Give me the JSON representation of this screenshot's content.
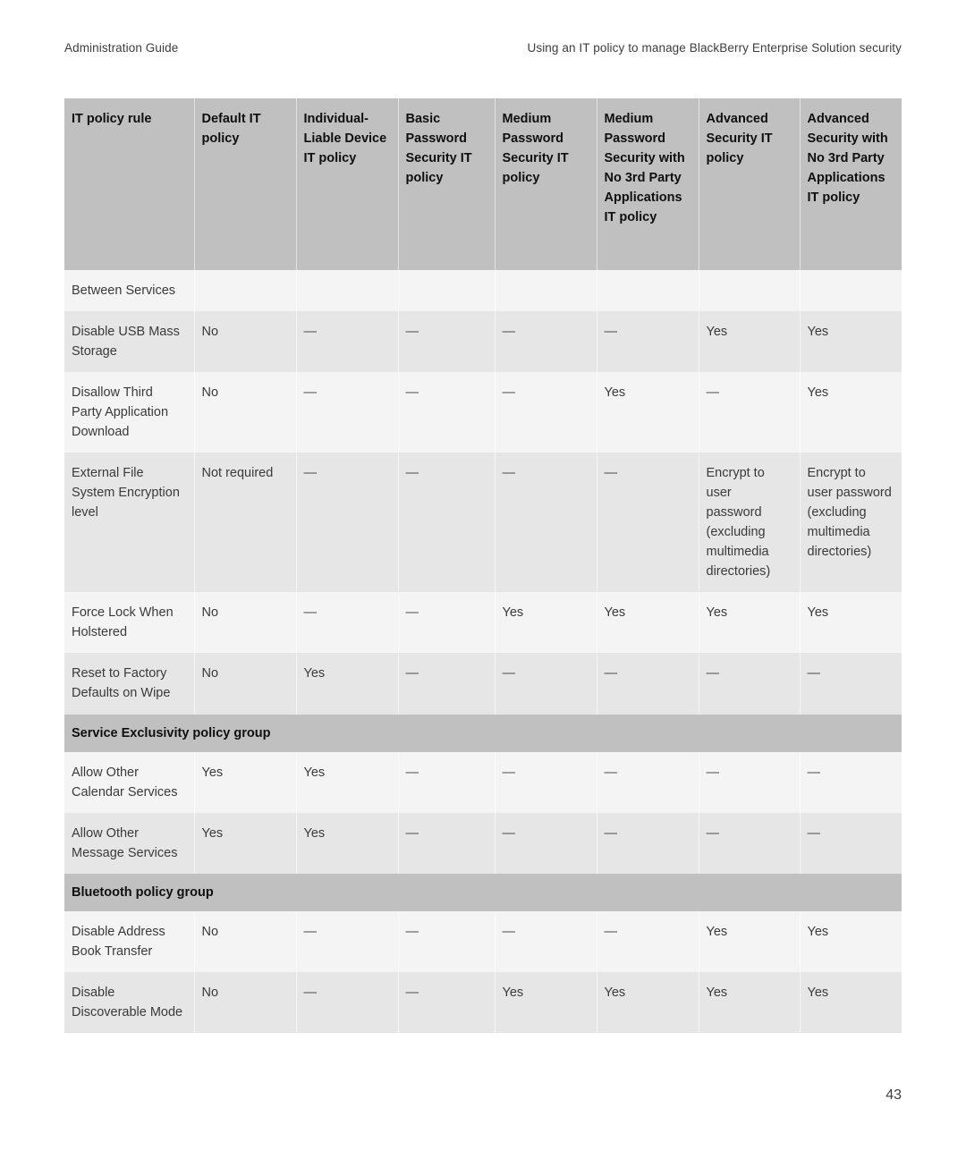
{
  "running_header": {
    "left": "Administration Guide",
    "right": "Using an IT policy to manage BlackBerry Enterprise Solution security"
  },
  "folio": "43",
  "table": {
    "columns": [
      "IT policy rule",
      "Default IT policy",
      "Individual-Liable Device IT policy",
      "Basic Password Security IT policy",
      "Medium Password Security IT policy",
      "Medium Password Security with No 3rd Party Applications IT policy",
      "Advanced Security IT policy",
      "Advanced Security with No 3rd Party Applications IT policy"
    ],
    "rows": [
      {
        "type": "data",
        "cells": [
          "Between Services",
          "",
          "",
          "",
          "",
          "",
          "",
          ""
        ]
      },
      {
        "type": "data",
        "cells": [
          "Disable USB Mass Storage",
          "No",
          "—",
          "—",
          "—",
          "—",
          "Yes",
          "Yes"
        ]
      },
      {
        "type": "data",
        "cells": [
          "Disallow Third Party Application Download",
          "No",
          "—",
          "—",
          "—",
          "Yes",
          "—",
          "Yes"
        ]
      },
      {
        "type": "data",
        "cells": [
          "External File System Encryption level",
          "Not required",
          "—",
          "—",
          "—",
          "—",
          "Encrypt to user password (excluding multimedia directories)",
          "Encrypt to user password (excluding multimedia directories)"
        ]
      },
      {
        "type": "data",
        "cells": [
          "Force Lock When Holstered",
          "No",
          "—",
          "—",
          "Yes",
          "Yes",
          "Yes",
          "Yes"
        ]
      },
      {
        "type": "data",
        "cells": [
          "Reset to Factory Defaults on Wipe",
          "No",
          "Yes",
          "—",
          "—",
          "—",
          "—",
          "—"
        ]
      },
      {
        "type": "group",
        "label": "Service Exclusivity policy group"
      },
      {
        "type": "data",
        "cells": [
          "Allow Other Calendar Services",
          "Yes",
          "Yes",
          "—",
          "—",
          "—",
          "—",
          "—"
        ]
      },
      {
        "type": "data",
        "cells": [
          "Allow Other Message Services",
          "Yes",
          "Yes",
          "—",
          "—",
          "—",
          "—",
          "—"
        ]
      },
      {
        "type": "group",
        "label": "Bluetooth policy group"
      },
      {
        "type": "data",
        "cells": [
          "Disable Address Book Transfer",
          "No",
          "—",
          "—",
          "—",
          "—",
          "Yes",
          "Yes"
        ]
      },
      {
        "type": "data",
        "cells": [
          "Disable Discoverable Mode",
          "No",
          "—",
          "—",
          "Yes",
          "Yes",
          "Yes",
          "Yes"
        ]
      }
    ]
  },
  "colors": {
    "header_bg": "#c0c0c0",
    "group_bg": "#c0c0c0",
    "row_light": "#f4f4f4",
    "row_dark": "#e6e6e6",
    "text": "#3a3a3a",
    "heading_text": "#0f0f0f"
  }
}
